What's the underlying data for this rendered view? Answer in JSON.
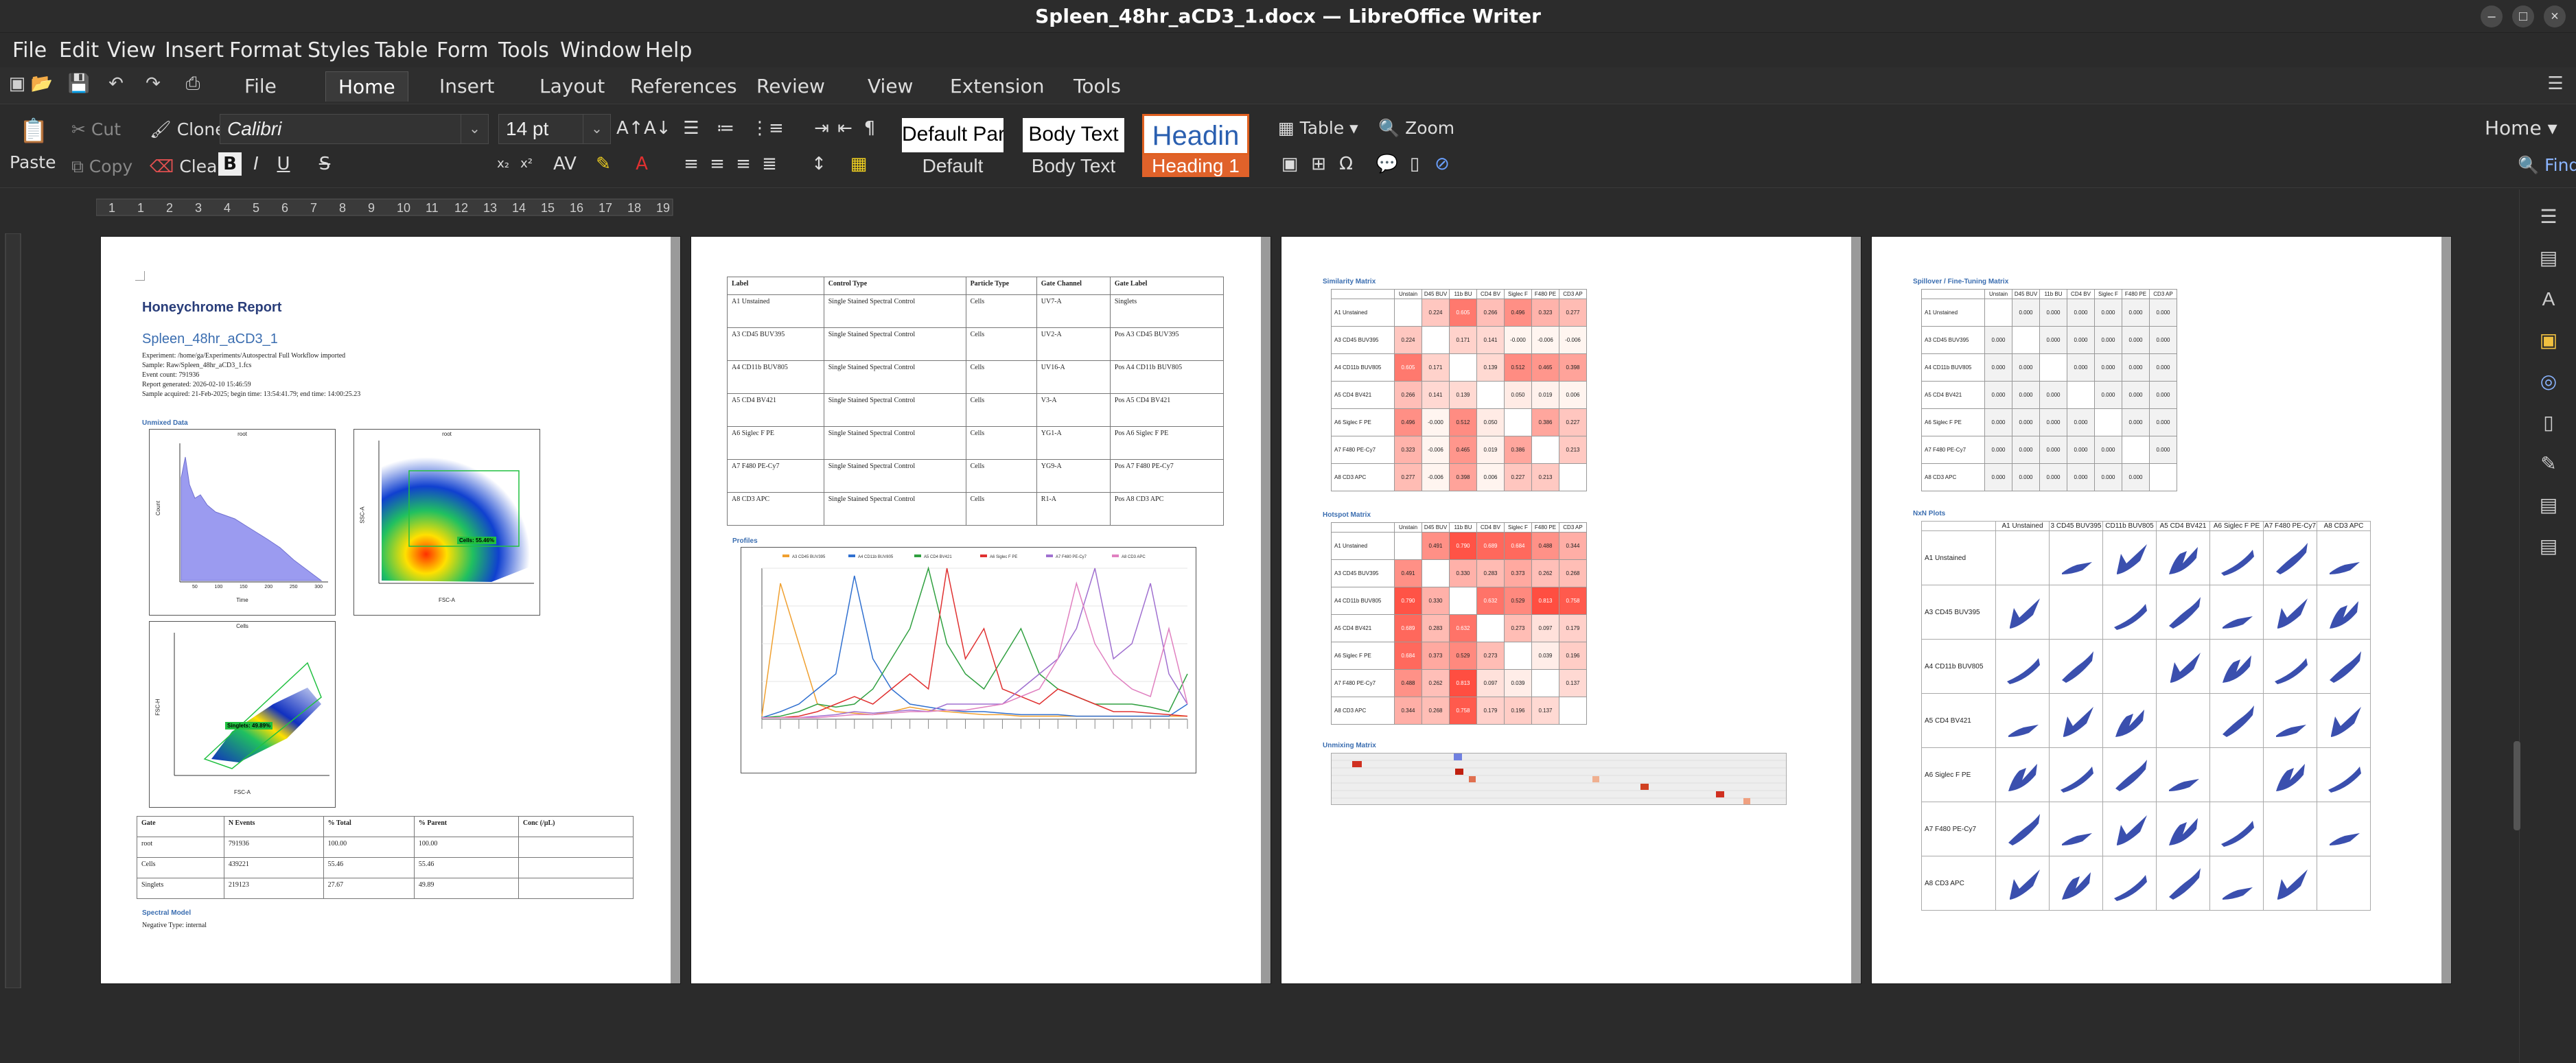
{
  "window": {
    "title": "Spleen_48hr_aCD3_1.docx — LibreOffice Writer"
  },
  "menubar": [
    "File",
    "Edit",
    "View",
    "Insert",
    "Format",
    "Styles",
    "Table",
    "Form",
    "Tools",
    "Window",
    "Help"
  ],
  "tabs": [
    "File",
    "Home",
    "Insert",
    "Layout",
    "References",
    "Review",
    "View",
    "Extension",
    "Tools"
  ],
  "active_tab": "Home",
  "toolbar": {
    "paste": "Paste",
    "cut": "Cut",
    "copy": "Copy",
    "clone": "Clone",
    "clear": "Clear",
    "font_name": "Calibri",
    "font_size": "14 pt",
    "table": "Table",
    "zoom": "Zoom",
    "home": "Home",
    "find": "Find"
  },
  "styles": [
    {
      "preview": "Default Par",
      "label": "Default"
    },
    {
      "preview": "Body Text",
      "label": "Body Text"
    },
    {
      "preview": "Headin",
      "label": "Heading 1"
    }
  ],
  "ruler": {
    "marks": [
      "1",
      "1",
      "2",
      "3",
      "4",
      "5",
      "6",
      "7",
      "8",
      "9",
      "10",
      "11",
      "12",
      "13",
      "14",
      "15",
      "16",
      "17",
      "18",
      "19"
    ]
  },
  "page1": {
    "title": "Honeychrome Report",
    "subtitle": "Spleen_48hr_aCD3_1",
    "info": [
      "Experiment: /home/ga/Experiments/Autospectral Full Workflow imported",
      "Sample: Raw/Spleen_48hr_aCD3_1.fcs",
      "Event count: 791936",
      "Report generated: 2026-02-10 15:46:59",
      "Sample acquired: 21-Feb-2025; begin time: 13:54:41.79; end time: 14:00:25.23"
    ],
    "section_unmixed": "Unmixed Data",
    "hist_title": "root",
    "hist_ylabel": "Count",
    "hist_xlabel": "Time",
    "hist_ticks": [
      "50",
      "100",
      "150",
      "200",
      "250",
      "300"
    ],
    "dot1_title": "root",
    "dot1_gate": "Cells: 55.46%",
    "dot1_xlabel": "FSC-A",
    "dot1_ylabel": "SSC-A",
    "dot2_title": "Cells",
    "dot2_gate": "Singlets: 49.89%",
    "dot2_xlabel": "FSC-A",
    "dot2_ylabel": "FSC-H",
    "gate_table": {
      "headers": [
        "Gate",
        "N Events",
        "% Total",
        "% Parent",
        "Conc (/µL)"
      ],
      "rows": [
        [
          "root",
          "791936",
          "100.00",
          "100.00",
          ""
        ],
        [
          "Cells",
          "439221",
          "55.46",
          "55.46",
          ""
        ],
        [
          "Singlets",
          "219123",
          "27.67",
          "49.89",
          ""
        ]
      ]
    },
    "section_model": "Spectral Model",
    "negative_type": "Negative Type: internal"
  },
  "page2": {
    "control_table": {
      "headers": [
        "Label",
        "Control Type",
        "Particle Type",
        "Gate Channel",
        "Gate Label"
      ],
      "rows": [
        [
          "A1 Unstained",
          "Single Stained Spectral Control",
          "Cells",
          "UV7-A",
          "Singlets"
        ],
        [
          "A3 CD45 BUV395",
          "Single Stained Spectral Control",
          "Cells",
          "UV2-A",
          "Pos A3 CD45 BUV395"
        ],
        [
          "A4 CD11b BUV805",
          "Single Stained Spectral Control",
          "Cells",
          "UV16-A",
          "Pos A4 CD11b BUV805"
        ],
        [
          "A5 CD4 BV421",
          "Single Stained Spectral Control",
          "Cells",
          "V3-A",
          "Pos A5 CD4 BV421"
        ],
        [
          "A6 Siglec F PE",
          "Single Stained Spectral Control",
          "Cells",
          "YG1-A",
          "Pos A6 Siglec F PE"
        ],
        [
          "A7 F480 PE-Cy7",
          "Single Stained Spectral Control",
          "Cells",
          "YG9-A",
          "Pos A7 F480 PE-Cy7"
        ],
        [
          "A8 CD3 APC",
          "Single Stained Spectral Control",
          "Cells",
          "R1-A",
          "Pos A8 CD3 APC"
        ]
      ]
    },
    "section_profiles": "Profiles"
  },
  "chart_data": {
    "type": "line",
    "title": "",
    "xlabel": "",
    "ylabel": "",
    "series": [
      {
        "name": "A3 CD45 BUV395",
        "color": "#f0a030",
        "values": [
          0.02,
          0.9,
          0.5,
          0.1,
          0.05,
          0.04,
          0.03,
          0.05,
          0.08,
          0.06,
          0.05,
          0.04,
          0.03,
          0.03,
          0.02,
          0.02,
          0.02,
          0.02,
          0.02,
          0.02,
          0.02,
          0.02,
          0.02,
          0.02
        ]
      },
      {
        "name": "A4 CD11b BUV805",
        "color": "#3070d0",
        "values": [
          0.01,
          0.05,
          0.1,
          0.2,
          0.3,
          0.95,
          0.4,
          0.2,
          0.1,
          0.08,
          0.06,
          0.05,
          0.05,
          0.04,
          0.03,
          0.03,
          0.03,
          0.02,
          0.02,
          0.02,
          0.02,
          0.02,
          0.02,
          0.1
        ]
      },
      {
        "name": "A5 CD4 BV421",
        "color": "#30a040",
        "values": [
          0.01,
          0.02,
          0.05,
          0.1,
          0.08,
          0.1,
          0.2,
          0.4,
          0.6,
          1.0,
          0.5,
          0.3,
          0.2,
          0.4,
          0.6,
          0.3,
          0.2,
          0.15,
          0.1,
          0.1,
          0.1,
          0.08,
          0.05,
          0.3
        ]
      },
      {
        "name": "A6 Siglec F PE",
        "color": "#e03030",
        "values": [
          0.01,
          0.01,
          0.02,
          0.05,
          0.1,
          0.15,
          0.1,
          0.2,
          0.3,
          0.2,
          1.0,
          0.4,
          0.6,
          0.2,
          0.15,
          0.1,
          0.2,
          0.15,
          0.1,
          0.05,
          0.05,
          0.04,
          0.03,
          0.02
        ]
      },
      {
        "name": "A7 F480 PE-Cy7",
        "color": "#a070d0",
        "values": [
          0.01,
          0.01,
          0.01,
          0.02,
          0.03,
          0.05,
          0.04,
          0.05,
          0.06,
          0.05,
          0.1,
          0.1,
          0.1,
          0.1,
          0.2,
          0.3,
          0.4,
          0.6,
          1.0,
          0.4,
          0.5,
          0.9,
          0.3,
          0.1
        ]
      },
      {
        "name": "A8 CD3 APC",
        "color": "#e080c0",
        "values": [
          0.01,
          0.01,
          0.01,
          0.01,
          0.02,
          0.03,
          0.03,
          0.04,
          0.05,
          0.05,
          0.06,
          0.06,
          0.08,
          0.1,
          0.15,
          0.2,
          0.4,
          0.9,
          0.5,
          0.3,
          0.2,
          0.15,
          0.6,
          0.1
        ]
      }
    ]
  },
  "page3": {
    "similarity_title": "Similarity Matrix",
    "hotspot_title": "Hotspot Matrix",
    "unmixing_title": "Unmixing Matrix",
    "headers": [
      "Unstain",
      "D45 BUV",
      "11b BU",
      "CD4 BV",
      "Siglec F",
      "F480 PE",
      "CD3 AP"
    ],
    "rows": [
      "A1 Unstained",
      "A3 CD45 BUV395",
      "A4 CD11b BUV805",
      "A5 CD4 BV421",
      "A6 Siglec F PE",
      "A7 F480 PE-Cy7",
      "A8 CD3 APC"
    ],
    "similarity": [
      [
        "",
        "0.224",
        "0.605",
        "0.266",
        "0.496",
        "0.323",
        "0.277"
      ],
      [
        "0.224",
        "",
        "0.171",
        "0.141",
        "-0.000",
        "-0.006",
        "-0.006"
      ],
      [
        "0.605",
        "0.171",
        "",
        "0.139",
        "0.512",
        "0.465",
        "0.398"
      ],
      [
        "0.266",
        "0.141",
        "0.139",
        "",
        "0.050",
        "0.019",
        "0.006"
      ],
      [
        "0.496",
        "-0.000",
        "0.512",
        "0.050",
        "",
        "0.386",
        "0.227"
      ],
      [
        "0.323",
        "-0.006",
        "0.465",
        "0.019",
        "0.386",
        "",
        "0.213"
      ],
      [
        "0.277",
        "-0.006",
        "0.398",
        "0.006",
        "0.227",
        "0.213",
        ""
      ]
    ],
    "hotspot": [
      [
        "",
        "0.491",
        "0.790",
        "0.689",
        "0.684",
        "0.488",
        "0.344"
      ],
      [
        "0.491",
        "",
        "0.330",
        "0.283",
        "0.373",
        "0.262",
        "0.268"
      ],
      [
        "0.790",
        "0.330",
        "",
        "0.632",
        "0.529",
        "0.813",
        "0.758"
      ],
      [
        "0.689",
        "0.283",
        "0.632",
        "",
        "0.273",
        "0.097",
        "0.179"
      ],
      [
        "0.684",
        "0.373",
        "0.529",
        "0.273",
        "",
        "0.039",
        "0.196"
      ],
      [
        "0.488",
        "0.262",
        "0.813",
        "0.097",
        "0.039",
        "",
        "0.137"
      ],
      [
        "0.344",
        "0.268",
        "0.758",
        "0.179",
        "0.196",
        "0.137",
        ""
      ]
    ]
  },
  "page4": {
    "spillover_title": "Spillover / Fine-Tuning Matrix",
    "headers": [
      "Unstain",
      "D45 BUV",
      "11b BU",
      "CD4 BV",
      "Siglec F",
      "F480 PE",
      "CD3 AP"
    ],
    "rows": [
      "A1 Unstained",
      "A3 CD45 BUV395",
      "A4 CD11b BUV805",
      "A5 CD4 BV421",
      "A6 Siglec F PE",
      "A7 F480 PE-Cy7",
      "A8 CD3 APC"
    ],
    "zero": "0.000",
    "nxn_title": "NxN Plots",
    "nxn_headers": [
      "A1 Unstained",
      "3 CD45 BUV395",
      "CD11b BUV805",
      "A5 CD4 BV421",
      "A6 Siglec F PE",
      "A7 F480 PE-Cy7",
      "A8 CD3 APC"
    ]
  }
}
